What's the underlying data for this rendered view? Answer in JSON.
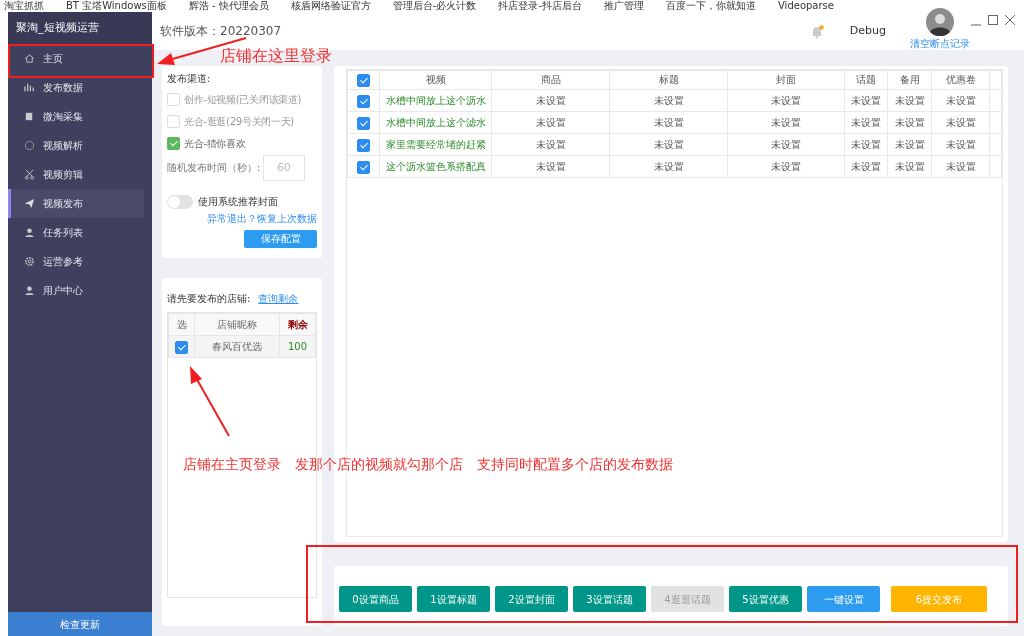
{
  "bookmarks": [
    {
      "label": "淘宝抓抓"
    },
    {
      "label": "BT 宝塔Windows面板"
    },
    {
      "label": "辉浩 - 快代理会员"
    },
    {
      "label": "核盾网络验证官方"
    },
    {
      "label": "管理后台-必火计数"
    },
    {
      "label": "抖店登录-抖店后台"
    },
    {
      "label": "推广管理"
    },
    {
      "label": "百度一下，你就知道"
    },
    {
      "label": "Videoparse"
    }
  ],
  "app": {
    "title": "聚淘_短视频运营",
    "version": "软件版本：20220307",
    "notification_unread": true,
    "debug": "Debug",
    "clear_link": "清空断点记录"
  },
  "sidebar": {
    "items": [
      {
        "label": "主页",
        "selected": false
      },
      {
        "label": "发布数据",
        "selected": false
      },
      {
        "label": "微淘采集",
        "selected": false
      },
      {
        "label": "视频解析",
        "selected": false
      },
      {
        "label": "视频剪辑",
        "selected": false
      },
      {
        "label": "视频发布",
        "selected": true
      },
      {
        "label": "任务列表",
        "selected": false
      },
      {
        "label": "运营参考",
        "selected": false
      },
      {
        "label": "用户中心",
        "selected": false
      }
    ],
    "footer_button": "检查更新"
  },
  "publish_settings": {
    "title": "发布渠道:",
    "channels": [
      {
        "label": "创作-短视频(已关闭该渠道)",
        "checked": false
      },
      {
        "label": "光合-逛逛(29号关闭一天)",
        "checked": false
      },
      {
        "label": "光合-猜你喜欢",
        "checked": true
      }
    ],
    "interval_label": "随机发布时间（秒）:",
    "interval_placeholder": "60",
    "toggle": {
      "label": "使用系统推荐封面",
      "on": false
    },
    "restore_link": "异常退出？恢复上次数据",
    "save_button": "保存配置"
  },
  "shops": {
    "title": "请先要发布的店铺:",
    "query_link": "查询剩余",
    "columns": [
      "选",
      "店铺昵称",
      "剩余"
    ],
    "rows": [
      {
        "checked": true,
        "name": "春风百优选",
        "remaining": "100"
      }
    ]
  },
  "videos": {
    "header_checked": true,
    "columns": [
      "视频",
      "商品",
      "标题",
      "封面",
      "话题",
      "备用",
      "优惠卷"
    ],
    "rows": [
      {
        "checked": true,
        "cells": [
          "水槽中间放上这个沥水",
          "未设置",
          "未设置",
          "未设置",
          "未设置",
          "未设置",
          "未设置"
        ]
      },
      {
        "checked": true,
        "cells": [
          "水槽中间放上这个滤水",
          "未设置",
          "未设置",
          "未设置",
          "未设置",
          "未设置",
          "未设置"
        ]
      },
      {
        "checked": true,
        "cells": [
          "家里需要经常堵的赶紧",
          "未设置",
          "未设置",
          "未设置",
          "未设置",
          "未设置",
          "未设置"
        ]
      },
      {
        "checked": true,
        "cells": [
          "这个沥水篮色系搭配真",
          "未设置",
          "未设置",
          "未设置",
          "未设置",
          "未设置",
          "未设置"
        ]
      }
    ]
  },
  "actions": [
    {
      "label": "0设置商品",
      "kind": "step",
      "disabled": false
    },
    {
      "label": "1设置标题",
      "kind": "step",
      "disabled": false
    },
    {
      "label": "2设置封面",
      "kind": "step",
      "disabled": false
    },
    {
      "label": "3设置话题",
      "kind": "step",
      "disabled": false
    },
    {
      "label": "4逛逛话题",
      "kind": "step",
      "disabled": true
    },
    {
      "label": "5设置优惠",
      "kind": "step",
      "disabled": false
    },
    {
      "label": "一键设置",
      "kind": "batch",
      "disabled": false
    },
    {
      "label": "6提交发布",
      "kind": "submit",
      "disabled": false
    }
  ],
  "annotations": [
    {
      "text": "店铺在这里登录"
    },
    {
      "text": "店铺在主页登录　发那个店的视频就勾那个店　支持同时配置多个店的发布数据"
    }
  ]
}
